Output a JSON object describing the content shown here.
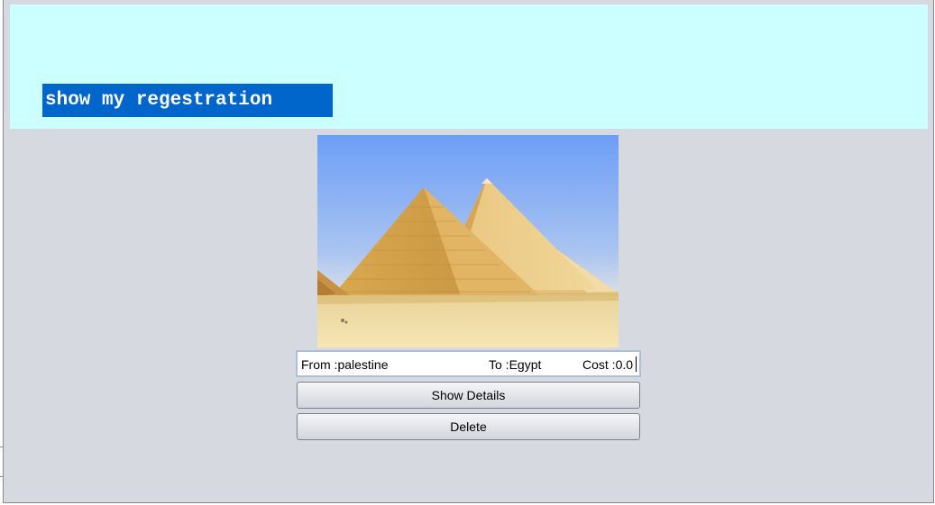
{
  "header": {
    "title": "show my regestration",
    "background_color": "#ccffff",
    "banner_color": "#0066cc"
  },
  "image": {
    "icon": "pyramids-photo"
  },
  "summary": {
    "from_label": "From :palestine",
    "to_label": "To :Egypt",
    "cost_label": "Cost :0.0"
  },
  "buttons": {
    "show_details": "Show Details",
    "delete": "Delete"
  }
}
